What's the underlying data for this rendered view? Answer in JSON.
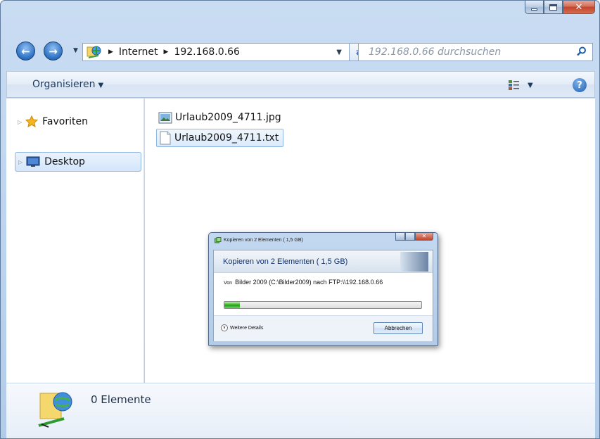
{
  "window": {
    "caption_buttons": {
      "minimize": "minimize-icon",
      "maximize": "maximize-icon",
      "close": "✕"
    }
  },
  "address": {
    "segments": [
      "Internet",
      "192.168.0.66"
    ],
    "search_placeholder": "192.168.0.66 durchsuchen"
  },
  "commandbar": {
    "organize_label": "Organisieren",
    "help_label": "?"
  },
  "navigation": {
    "items": [
      {
        "label": "Favoriten",
        "icon": "star-icon"
      },
      {
        "label": "Desktop",
        "icon": "desktop-icon",
        "selected": true
      }
    ]
  },
  "files": [
    {
      "name": "Urlaub2009_4711.jpg",
      "icon": "image-file-icon"
    },
    {
      "name": "Urlaub2009_4711.txt",
      "icon": "text-file-icon",
      "selected": true
    }
  ],
  "details": {
    "count_text": "0 Elemente"
  },
  "copy_dialog": {
    "title": "Kopieren von  2 Elementen ( 1,5 GB)",
    "heading": "Kopieren von  2 Elementen ( 1,5 GB)",
    "from_label": "Von",
    "from_text": "Bilder 2009 (C:\\Bilder2009) nach FTP:\\\\192.168.0.66",
    "progress_fraction": 0.08,
    "more_details_label": "Weitere Details",
    "cancel_label": "Abbrechen"
  },
  "colors": {
    "accent": "#2a6fc2",
    "progress": "#2fb31f",
    "close_red": "#c0452b"
  }
}
